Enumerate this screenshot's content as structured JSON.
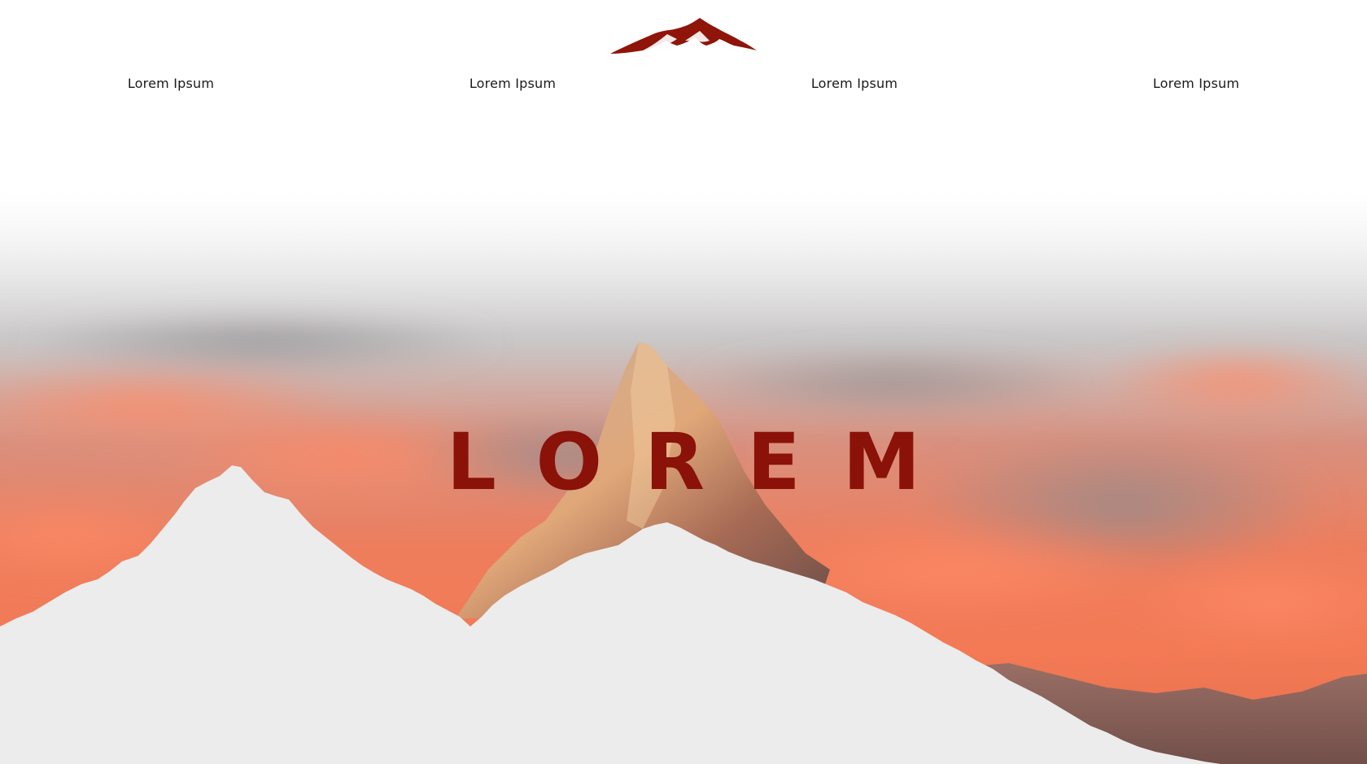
{
  "brand": {
    "logo_icon": "mountain-logo-icon",
    "accent_color": "#8f1409"
  },
  "nav": {
    "items": [
      {
        "label": "Lorem Ipsum"
      },
      {
        "label": "Lorem Ipsum"
      },
      {
        "label": "Lorem Ipsum"
      },
      {
        "label": "Lorem Ipsum"
      }
    ]
  },
  "hero": {
    "title": "LOREM",
    "background": "sunset-mountain-peak-image",
    "foreground": "white-mountain-silhouette"
  }
}
